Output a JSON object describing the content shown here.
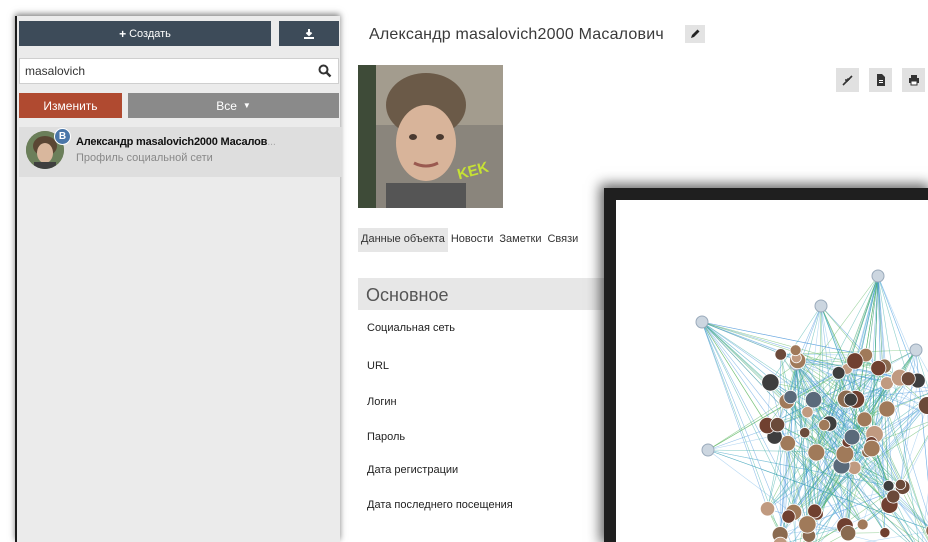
{
  "left_panel": {
    "create_label": "Создать",
    "search_value": "masalovich",
    "edit_label": "Изменить",
    "filter_label": "Все",
    "result": {
      "badge": "В",
      "title": "Александр masalovich2000 Масалов",
      "title_fade": "...",
      "subtitle": "Профиль социальной сети"
    }
  },
  "main": {
    "title": "Александр masalovich2000 Масалович",
    "tabs": [
      "Данные объекта",
      "Новости",
      "Заметки",
      "Связи"
    ],
    "section_title": "Основное",
    "fields": [
      "Социальная сеть",
      "URL",
      "Логин",
      "Пароль",
      "Дата регистрации",
      "Дата последнего посещения"
    ],
    "photo_text": "KEK"
  },
  "colors": {
    "dark_button": "#3d4b59",
    "edit_button": "#b04a30",
    "filter_button": "#8a8a8a"
  },
  "icons": [
    "plus-icon",
    "download-icon",
    "search-icon",
    "caret-down-icon",
    "pencil-icon",
    "collapse-icon",
    "document-icon",
    "print-icon"
  ]
}
